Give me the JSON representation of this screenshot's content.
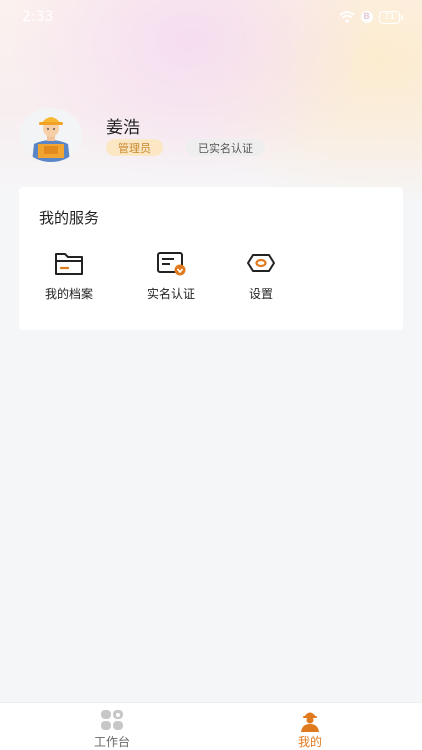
{
  "status_bar": {
    "time": "2:33",
    "bluetooth": "B",
    "battery": "71"
  },
  "profile": {
    "name": "姜浩",
    "role": "管理员",
    "verification": "已实名认证"
  },
  "services": {
    "title": "我的服务",
    "items": [
      {
        "label": "我的档案",
        "icon": "folder-icon"
      },
      {
        "label": "实名认证",
        "icon": "id-card-icon"
      },
      {
        "label": "设置",
        "icon": "settings-hex-icon"
      }
    ]
  },
  "tabs": [
    {
      "label": "工作台",
      "icon": "workbench-grid-icon",
      "active": false
    },
    {
      "label": "我的",
      "icon": "worker-profile-icon",
      "active": true
    }
  ],
  "colors": {
    "accent": "#e07a1f",
    "role_badge_bg": "#fbe7c4",
    "role_badge_text": "#c9892c"
  }
}
